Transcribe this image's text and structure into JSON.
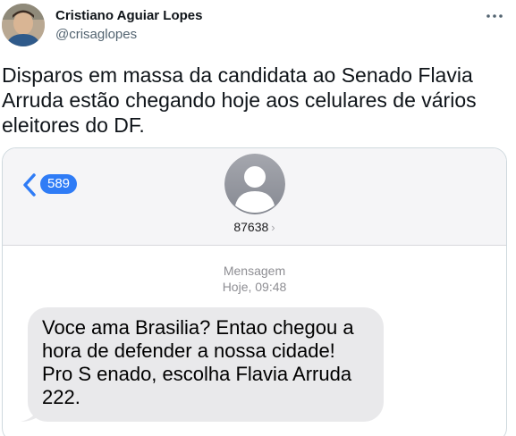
{
  "author": {
    "name": "Cristiano Aguiar Lopes",
    "handle": "@crisaglopes"
  },
  "tweet": {
    "text": "Disparos em massa da candidata ao Senado Flavia Arruda estão chegando hoje aos celulares de vários eleitores do DF."
  },
  "more_icon": "more-horizontal-icon",
  "sms": {
    "back_count": "589",
    "contact_number": "87638",
    "contact_chevron": "›",
    "meta_label": "Mensagem",
    "meta_time": "Hoje, 09:48",
    "message": "Voce ama Brasilia? Entao chegou a hora de defender a nossa cidade! Pro S enado, escolha Flavia Arruda 222."
  },
  "colors": {
    "imessage_blue": "#2f7cf6",
    "bubble_gray": "#e9e9eb",
    "header_bg": "#f5f5f7"
  }
}
